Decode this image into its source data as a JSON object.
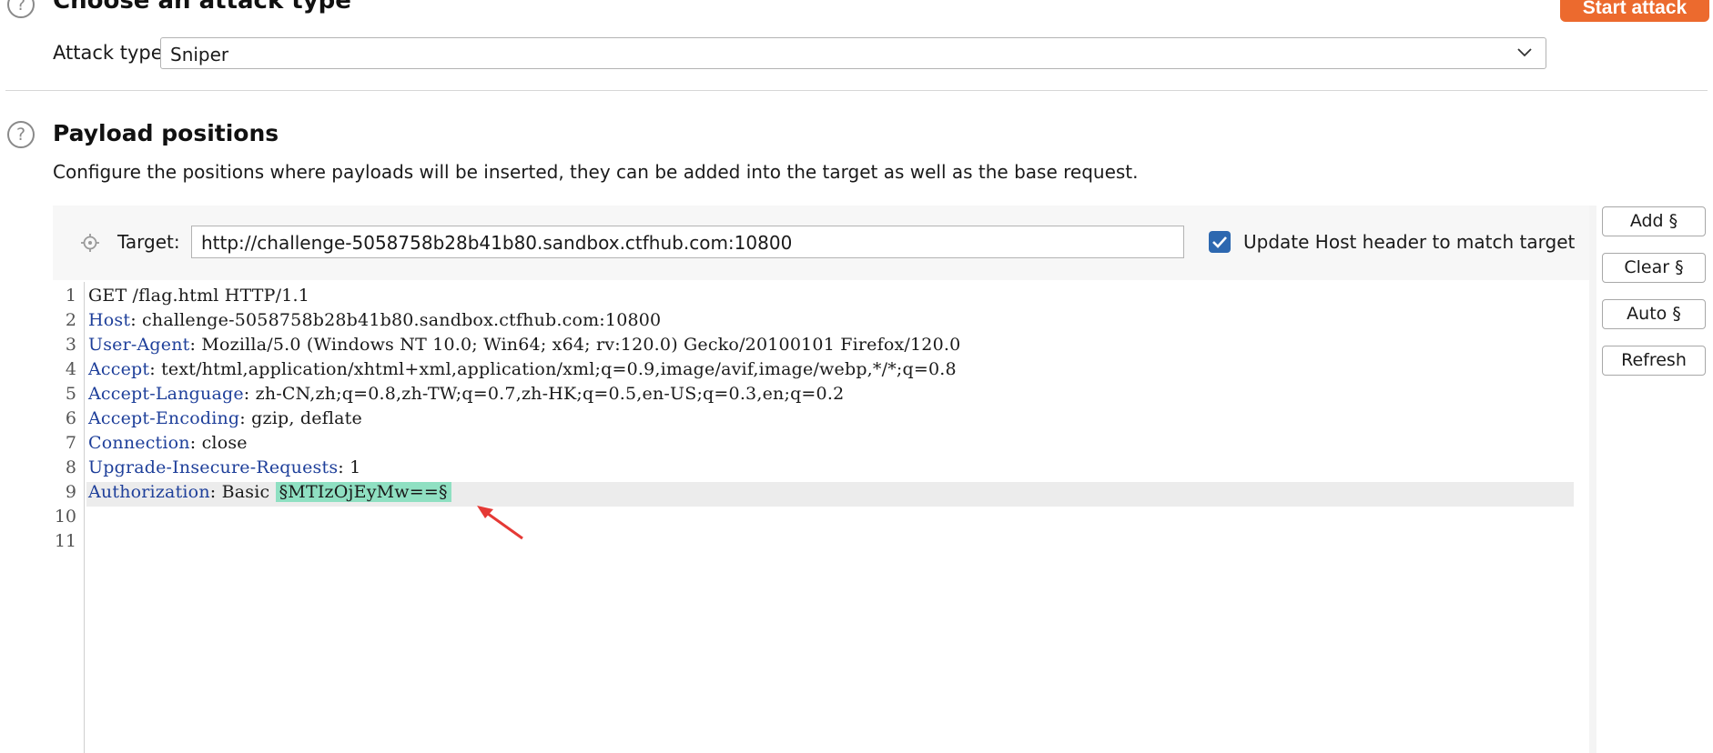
{
  "attack_type_section": {
    "title": "Choose an attack type",
    "attack_type_label": "Attack type:",
    "attack_type_value": "Sniper",
    "start_attack_label": "Start attack"
  },
  "payload_section": {
    "title": "Payload positions",
    "description": "Configure the positions where payloads will be inserted, they can be added into the target as well as the base request.",
    "target_label": "Target:",
    "target_value": "http://challenge-5058758b28b41b80.sandbox.ctfhub.com:10800",
    "update_host_label": "Update Host header to match target",
    "update_host_checked": true,
    "buttons": {
      "add": "Add §",
      "clear": "Clear §",
      "auto": "Auto §",
      "refresh": "Refresh"
    }
  },
  "request_editor": {
    "lines": [
      {
        "num": "1",
        "key": "",
        "value": "GET /flag.html HTTP/1.1"
      },
      {
        "num": "2",
        "key": "Host",
        "value": ": challenge-5058758b28b41b80.sandbox.ctfhub.com:10800"
      },
      {
        "num": "3",
        "key": "User-Agent",
        "value": ": Mozilla/5.0 (Windows NT 10.0; Win64; x64; rv:120.0) Gecko/20100101 Firefox/120.0"
      },
      {
        "num": "4",
        "key": "Accept",
        "value": ": text/html,application/xhtml+xml,application/xml;q=0.9,image/avif,image/webp,*/*;q=0.8"
      },
      {
        "num": "5",
        "key": "Accept-Language",
        "value": ": zh-CN,zh;q=0.8,zh-TW;q=0.7,zh-HK;q=0.5,en-US;q=0.3,en;q=0.2"
      },
      {
        "num": "6",
        "key": "Accept-Encoding",
        "value": ": gzip, deflate"
      },
      {
        "num": "7",
        "key": "Connection",
        "value": ": close"
      },
      {
        "num": "8",
        "key": "Upgrade-Insecure-Requests",
        "value": ": 1"
      },
      {
        "num": "9",
        "key": "Authorization",
        "value": ": Basic "
      },
      {
        "num": "10",
        "key": "",
        "value": ""
      },
      {
        "num": "11",
        "key": "",
        "value": ""
      }
    ],
    "payload_marker": "§MTIzOjEyMw==§"
  },
  "colors": {
    "accent": "#ec6a2e",
    "header_key": "#1e3f9a",
    "payload_highlight": "#8fe0c2",
    "checkbox": "#2d68b0",
    "annotation_arrow": "#e53935"
  }
}
